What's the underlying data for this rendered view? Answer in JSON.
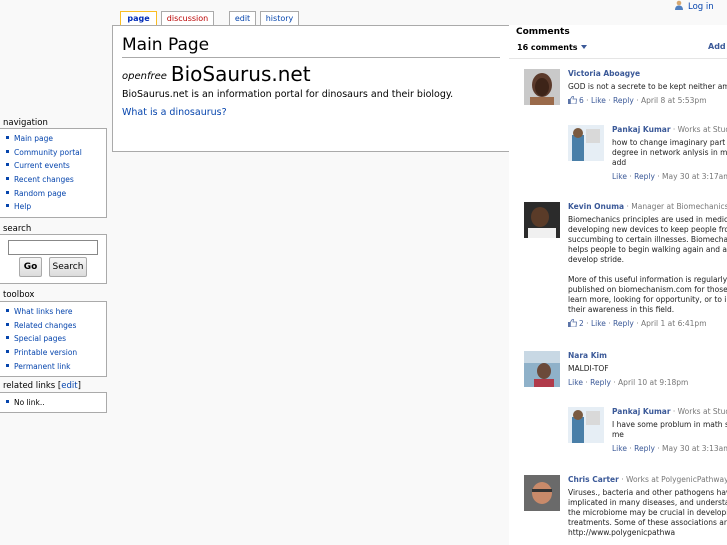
{
  "personal": {
    "login": "Log in"
  },
  "tabs": [
    {
      "label": "page"
    },
    {
      "label": "discussion"
    },
    {
      "label": "edit"
    },
    {
      "label": "history"
    }
  ],
  "content": {
    "heading": "Main Page",
    "site_small": "openfree",
    "site_big": "BioSaurus.net",
    "intro": "BioSaurus.net is an information portal for dinosaurs and their biology.",
    "link": "What is a dinosaurus?"
  },
  "sidebar": {
    "navigation": {
      "heading": "navigation",
      "items": [
        "Main page",
        "Community portal",
        "Current events",
        "Recent changes",
        "Random page",
        "Help"
      ]
    },
    "search": {
      "heading": "search",
      "go": "Go",
      "search": "Search",
      "value": ""
    },
    "toolbox": {
      "heading": "toolbox",
      "items": [
        "What links here",
        "Related changes",
        "Special pages",
        "Printable version",
        "Permanent link"
      ]
    },
    "related": {
      "heading": "related links",
      "edit": "edit",
      "items": [
        "No link.."
      ]
    }
  },
  "comments": {
    "title": "Comments",
    "count": "16 comments",
    "add": "Add a",
    "items": [
      {
        "author": "Victoria Aboagye",
        "info": "",
        "text": [
          "GOD is not a secrete to be kept neither am i"
        ],
        "likes": "6",
        "like": "Like",
        "reply": "Reply",
        "time": "April 8 at 5:53pm"
      },
      {
        "author": "Pankaj Kumar",
        "info": " · Works at Stude",
        "text": [
          "how to change imaginary part to",
          "degree in network anlysis in my r",
          "add"
        ],
        "like": "Like",
        "reply": "Reply",
        "time": "May 30 at 3:17am"
      },
      {
        "author": "Kevin Onuma",
        "info": " · Manager at Biomechanics",
        "text": [
          "Biomechanics principles are used in medicine",
          "developing new devices to keep people from",
          "succumbing to certain illnesses. Biomechanic",
          "helps people to begin walking again and also",
          "develop stride.",
          "",
          "More of this useful information is regularly",
          "published on biomechanism.com for those wil",
          "learn more, looking for opportunity, or to incre",
          "their awareness in this field."
        ],
        "likes": "2",
        "like": "Like",
        "reply": "Reply",
        "time": "April 1 at 6:41pm"
      },
      {
        "author": "Nara Kim",
        "info": "",
        "text": [
          "MALDI-TOF"
        ],
        "like": "Like",
        "reply": "Reply",
        "time": "April 10 at 9:18pm"
      },
      {
        "author": "Pankaj Kumar",
        "info": " · Works at Stude",
        "text": [
          "I have some problum in math so",
          "me"
        ],
        "like": "Like",
        "reply": "Reply",
        "time": "May 30 at 3:13am"
      },
      {
        "author": "Chris Carter",
        "info": " · Works at PolygenicPathways",
        "text": [
          "Viruses., bacteria and other pathogens have",
          "implicated in many diseases, and understand",
          "the microbiome may be crucial in developing",
          "treatments. Some of these associations are at",
          "http://www.polygenicpathwa"
        ],
        "like": "Like",
        "reply": "Reply",
        "time": ""
      }
    ]
  }
}
